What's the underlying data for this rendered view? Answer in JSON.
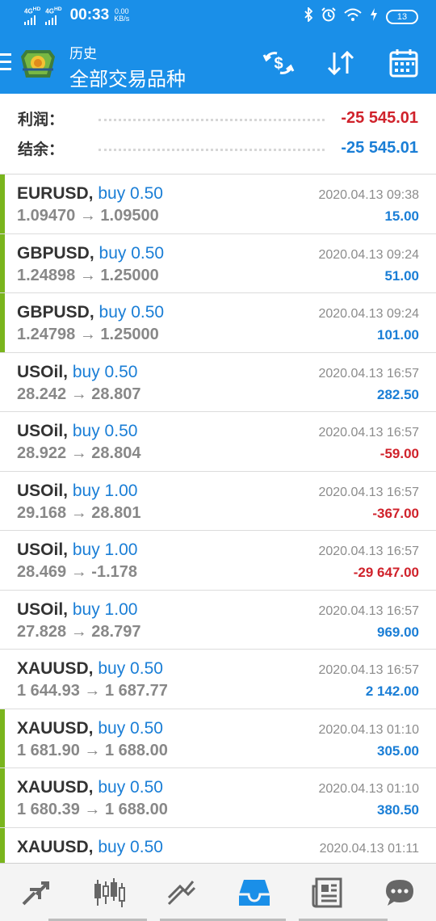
{
  "status_bar": {
    "net1": "4G",
    "net1_sup": "HD",
    "net2": "4G",
    "net2_sup": "HD",
    "time": "00:33",
    "speed_value": "0.00",
    "speed_unit": "KB/s",
    "battery": "13"
  },
  "toolbar": {
    "subtitle": "历史",
    "title": "全部交易品种"
  },
  "summary": {
    "profit_label": "利润：",
    "profit_value": "-25 545.01",
    "balance_label": "结余：",
    "balance_value": "-25 545.01"
  },
  "trades": [
    {
      "symbol": "EURUSD,",
      "action": "buy 0.50",
      "prices": "1.09470 → 1.09500",
      "time": "2020.04.13 09:38",
      "profit": "15.00",
      "negative": false,
      "flag": true
    },
    {
      "symbol": "GBPUSD,",
      "action": "buy 0.50",
      "prices": "1.24898 → 1.25000",
      "time": "2020.04.13 09:24",
      "profit": "51.00",
      "negative": false,
      "flag": true
    },
    {
      "symbol": "GBPUSD,",
      "action": "buy 0.50",
      "prices": "1.24798 → 1.25000",
      "time": "2020.04.13 09:24",
      "profit": "101.00",
      "negative": false,
      "flag": true
    },
    {
      "symbol": "USOil,",
      "action": "buy 0.50",
      "prices": "28.242 → 28.807",
      "time": "2020.04.13 16:57",
      "profit": "282.50",
      "negative": false,
      "flag": false
    },
    {
      "symbol": "USOil,",
      "action": "buy 0.50",
      "prices": "28.922 → 28.804",
      "time": "2020.04.13 16:57",
      "profit": "-59.00",
      "negative": true,
      "flag": false
    },
    {
      "symbol": "USOil,",
      "action": "buy 1.00",
      "prices": "29.168 → 28.801",
      "time": "2020.04.13 16:57",
      "profit": "-367.00",
      "negative": true,
      "flag": false
    },
    {
      "symbol": "USOil,",
      "action": "buy 1.00",
      "prices": "28.469 → -1.178",
      "time": "2020.04.13 16:57",
      "profit": "-29 647.00",
      "negative": true,
      "flag": false
    },
    {
      "symbol": "USOil,",
      "action": "buy 1.00",
      "prices": "27.828 → 28.797",
      "time": "2020.04.13 16:57",
      "profit": "969.00",
      "negative": false,
      "flag": false
    },
    {
      "symbol": "XAUUSD,",
      "action": "buy 0.50",
      "prices": "1 644.93 → 1 687.77",
      "time": "2020.04.13 16:57",
      "profit": "2 142.00",
      "negative": false,
      "flag": false
    },
    {
      "symbol": "XAUUSD,",
      "action": "buy 0.50",
      "prices": "1 681.90 → 1 688.00",
      "time": "2020.04.13 01:10",
      "profit": "305.00",
      "negative": false,
      "flag": true
    },
    {
      "symbol": "XAUUSD,",
      "action": "buy 0.50",
      "prices": "1 680.39 → 1 688.00",
      "time": "2020.04.13 01:10",
      "profit": "380.50",
      "negative": false,
      "flag": true
    },
    {
      "symbol": "XAUUSD,",
      "action": "buy 0.50",
      "prices": "",
      "time": "2020.04.13 01:11",
      "profit": "",
      "negative": false,
      "flag": true
    }
  ],
  "colors": {
    "primary": "#1a8fe8",
    "positive": "#1a7ed6",
    "negative": "#d0222b",
    "flag": "#7ab51d"
  },
  "icons": {
    "toolbar": [
      "currency-exchange-icon",
      "sort-icon",
      "calendar-icon"
    ],
    "nav": [
      "quotes-icon",
      "chart-icon",
      "trade-icon",
      "history-icon",
      "news-icon",
      "chat-icon"
    ]
  }
}
